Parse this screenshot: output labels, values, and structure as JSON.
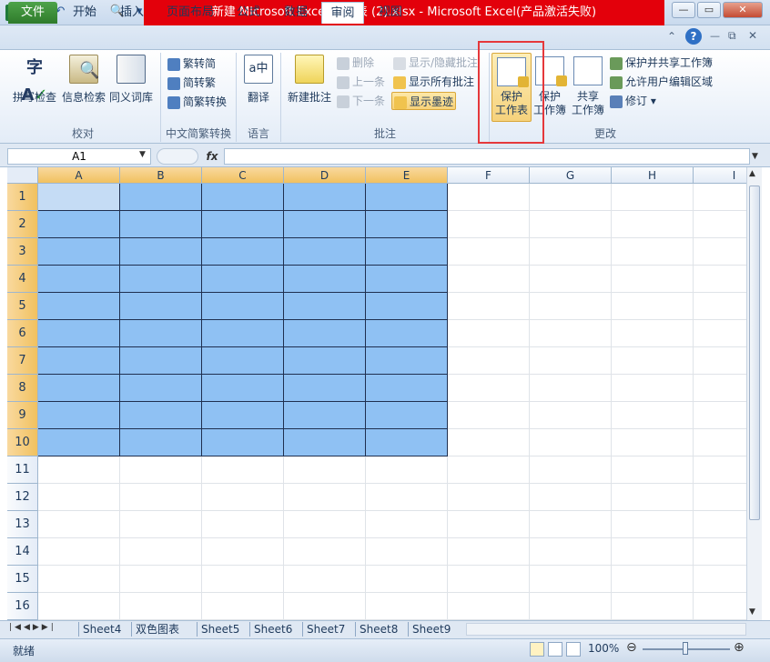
{
  "window": {
    "title": "新建 Microsoft Excel 工作表 (2).xlsx  -  Microsoft Excel(产品激活失败)",
    "controls": {
      "minimize": "—",
      "restore": "▭",
      "close": "✕"
    }
  },
  "qat": {
    "save_icon": "💾",
    "undo_icon": "↶",
    "redo_icon": "↷",
    "print_preview_icon": "🔍",
    "customize": "▾"
  },
  "tabs": [
    "文件",
    "开始",
    "插入",
    "页面布局",
    "公式",
    "数据",
    "审阅",
    "视图"
  ],
  "active_tab": "审阅",
  "ribbon": {
    "proofing": {
      "label": "校对",
      "spell": "拼写检查",
      "research": "信息检索",
      "thesaurus": "同义词库"
    },
    "chinese": {
      "label": "中文简繁转换",
      "to_trad": "繁转简",
      "to_simp": "简转繁",
      "convert": "简繁转换"
    },
    "language": {
      "label": "语言",
      "translate": "翻译"
    },
    "comments": {
      "label": "批注",
      "new": "新建批注",
      "delete": "删除",
      "prev": "上一条",
      "next": "下一条",
      "show_hide": "显示/隐藏批注",
      "show_all": "显示所有批注",
      "show_ink": "显示墨迹"
    },
    "changes": {
      "label": "更改",
      "protect_sheet": "保护\n工作表",
      "protect_sheet_l1": "保护",
      "protect_sheet_l2": "工作表",
      "protect_wb_l1": "保护",
      "protect_wb_l2": "工作簿",
      "share_l1": "共享",
      "share_l2": "工作簿",
      "protect_share": "保护并共享工作簿",
      "allow_edit": "允许用户编辑区域",
      "track": "修订"
    }
  },
  "formula_bar": {
    "name_box": "A1",
    "fx": "fx",
    "value": ""
  },
  "columns": [
    "A",
    "B",
    "C",
    "D",
    "E",
    "F",
    "G",
    "H",
    "I"
  ],
  "rows": [
    "1",
    "2",
    "3",
    "4",
    "5",
    "6",
    "7",
    "8",
    "9",
    "10",
    "11",
    "12",
    "13",
    "14",
    "15",
    "16"
  ],
  "selection": {
    "cols": 5,
    "rows": 10
  },
  "sheet_tabs": [
    "Sheet4",
    "双色图表",
    "Sheet5",
    "Sheet6",
    "Sheet7",
    "Sheet8",
    "Sheet9"
  ],
  "status": {
    "ready": "就绪",
    "zoom": "100%"
  },
  "colors": {
    "selection": "#8fc1f3",
    "header_selected": "#f1c15f",
    "highlight_box": "#e5383b",
    "file_tab": "#3b8f36"
  }
}
